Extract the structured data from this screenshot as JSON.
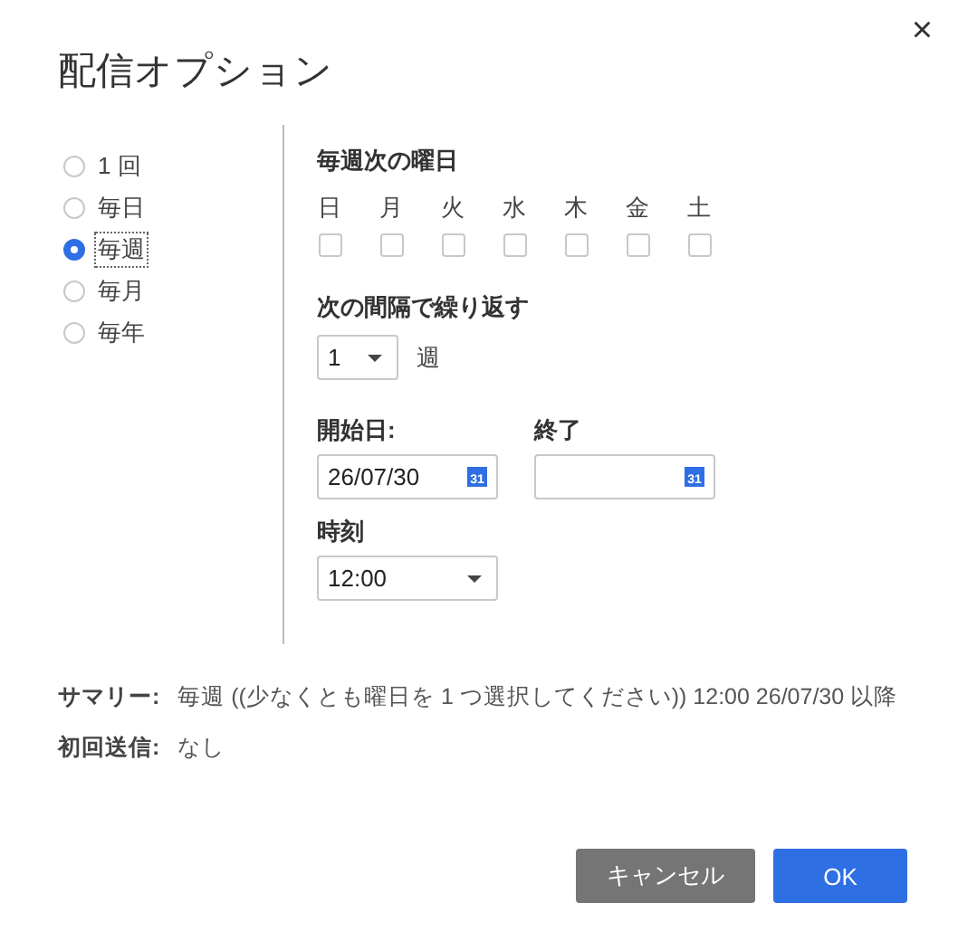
{
  "dialog": {
    "title": "配信オプション",
    "close": "×"
  },
  "frequency": [
    {
      "label": "1 回",
      "selected": false
    },
    {
      "label": "毎日",
      "selected": false
    },
    {
      "label": "毎週",
      "selected": true
    },
    {
      "label": "毎月",
      "selected": false
    },
    {
      "label": "毎年",
      "selected": false
    }
  ],
  "weekdays": {
    "heading": "毎週次の曜日",
    "days": [
      {
        "label": "日",
        "checked": false
      },
      {
        "label": "月",
        "checked": false
      },
      {
        "label": "火",
        "checked": false
      },
      {
        "label": "水",
        "checked": false
      },
      {
        "label": "木",
        "checked": false
      },
      {
        "label": "金",
        "checked": false
      },
      {
        "label": "土",
        "checked": false
      }
    ]
  },
  "interval": {
    "heading": "次の間隔で繰り返す",
    "value": "1",
    "unit": "週"
  },
  "start_date": {
    "label": "開始日:",
    "value": "26/07/30",
    "icon_label": "31"
  },
  "end_date": {
    "label": "終了",
    "icon_label": "31"
  },
  "time": {
    "label": "時刻",
    "value": "12:00"
  },
  "summary": [
    {
      "label": "サマリー:",
      "value": "毎週 ((少なくとも曜日を 1 つ選択してください)) 12:00 26/07/30 以降"
    },
    {
      "label": "初回送信:",
      "value": "なし"
    }
  ],
  "buttons": [
    {
      "label": "キャンセル",
      "kind": "secondary"
    },
    {
      "label": "OK",
      "kind": "primary"
    }
  ]
}
